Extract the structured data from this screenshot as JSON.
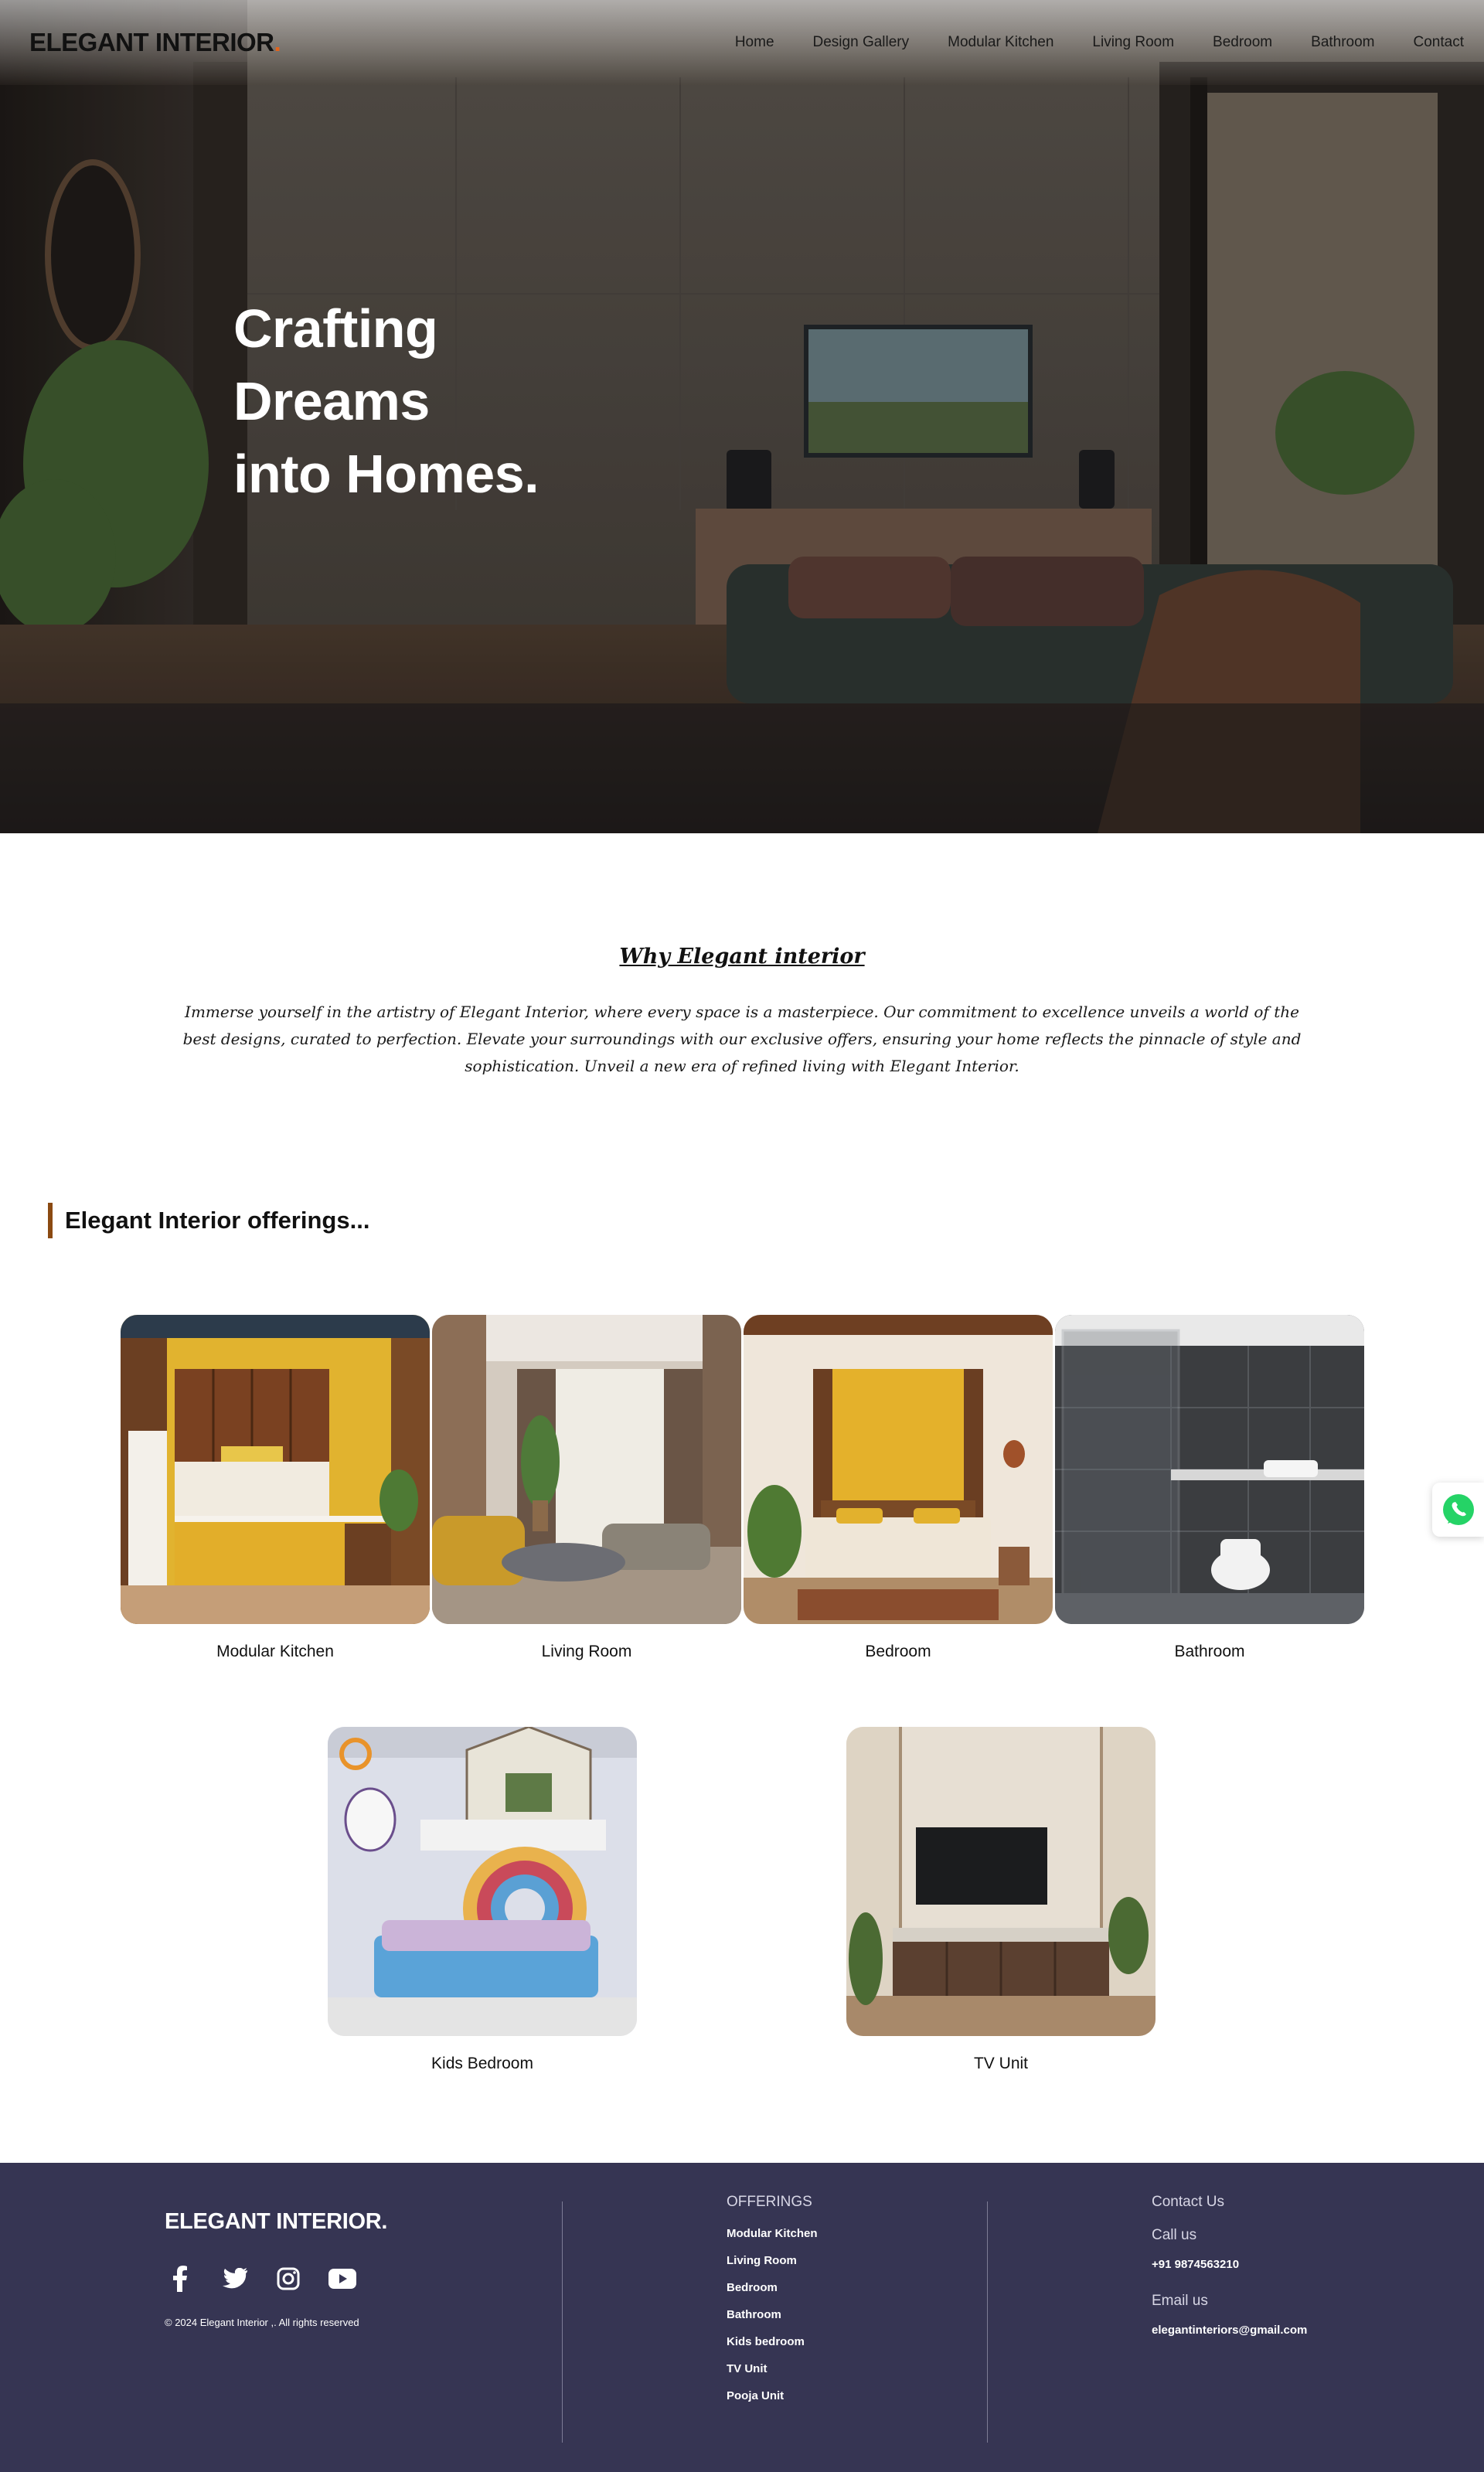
{
  "nav": {
    "brand": "ELEGANT INTERIOR",
    "brand_dot": ".",
    "links": [
      "Home",
      "Design Gallery",
      "Modular Kitchen",
      "Living Room",
      "Bedroom",
      "Bathroom",
      "Contact"
    ]
  },
  "hero": {
    "line1": "Crafting",
    "line2": "Dreams",
    "line3": "into Homes."
  },
  "why": {
    "title": "Why Elegant interior",
    "text": "Immerse yourself in the artistry of Elegant Interior, where every space is a masterpiece. Our commitment to excellence unveils a world of the best designs, curated to perfection. Elevate your surroundings with our exclusive offers, ensuring your home reflects the pinnacle of style and sophistication. Unveil a new era of refined living with Elegant Interior."
  },
  "offerings": {
    "heading": "Elegant Interior offerings...",
    "cards": [
      {
        "label": "Modular Kitchen"
      },
      {
        "label": "Living Room"
      },
      {
        "label": "Bedroom"
      },
      {
        "label": "Bathroom"
      },
      {
        "label": "Kids Bedroom"
      },
      {
        "label": "TV Unit"
      }
    ]
  },
  "footer": {
    "brand": "ELEGANT INTERIOR.",
    "social_icons": [
      "facebook-icon",
      "twitter-icon",
      "instagram-icon",
      "youtube-icon"
    ],
    "copyright": "© 2024 Elegant Interior ,. All rights reserved",
    "offerings_title": "OFFERINGS",
    "offerings_links": [
      "Modular Kitchen",
      "Living Room",
      "Bedroom",
      "Bathroom",
      "Kids bedroom",
      "TV Unit",
      "Pooja Unit"
    ],
    "contact_title": "Contact Us",
    "call_label": "Call us",
    "phone": "+91 9874563210",
    "email_label": "Email us",
    "email": "elegantinteriors@gmail.com"
  },
  "colors": {
    "accent": "#e2641d",
    "offer_bar": "#8b4a12",
    "footer_bg": "#363553",
    "whatsapp": "#25d366"
  }
}
